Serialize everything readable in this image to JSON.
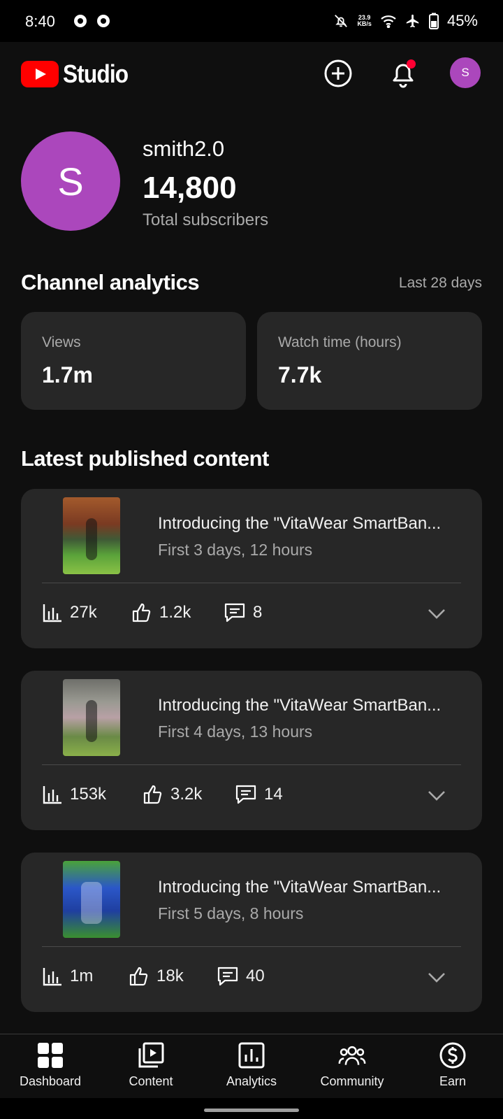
{
  "status_bar": {
    "time": "8:40",
    "net_speed_value": "23.9",
    "net_speed_unit": "KB/s",
    "battery_percent": "45%",
    "icons": [
      "chrome-icon",
      "chrome-icon",
      "bell-off-icon",
      "wifi-icon",
      "airplane-icon",
      "battery-icon"
    ]
  },
  "header": {
    "logo_text": "Studio",
    "avatar_letter": "S",
    "brand_color": "#ff0000",
    "avatar_color": "#ab47bc",
    "notification_dot_color": "#ff0033"
  },
  "channel": {
    "avatar_letter": "S",
    "name": "smith2.0",
    "subscriber_count": "14,800",
    "subscriber_label": "Total subscribers"
  },
  "analytics": {
    "title": "Channel analytics",
    "range": "Last 28 days",
    "cards": [
      {
        "label": "Views",
        "value": "1.7m"
      },
      {
        "label": "Watch time (hours)",
        "value": "7.7k"
      }
    ]
  },
  "latest": {
    "title": "Latest published content",
    "items": [
      {
        "title": "Introducing the \"VitaWear SmartBan...",
        "subtitle": "First 3 days, 12 hours",
        "views": "27k",
        "likes": "1.2k",
        "comments": "8"
      },
      {
        "title": "Introducing the \"VitaWear SmartBan...",
        "subtitle": "First 4 days, 13 hours",
        "views": "153k",
        "likes": "3.2k",
        "comments": "14"
      },
      {
        "title": "Introducing the \"VitaWear SmartBan...",
        "subtitle": "First 5 days, 8 hours",
        "views": "1m",
        "likes": "18k",
        "comments": "40"
      }
    ]
  },
  "bottom_nav": {
    "items": [
      {
        "label": "Dashboard",
        "icon": "dashboard-icon"
      },
      {
        "label": "Content",
        "icon": "content-icon"
      },
      {
        "label": "Analytics",
        "icon": "analytics-icon"
      },
      {
        "label": "Community",
        "icon": "community-icon"
      },
      {
        "label": "Earn",
        "icon": "earn-icon"
      }
    ]
  }
}
